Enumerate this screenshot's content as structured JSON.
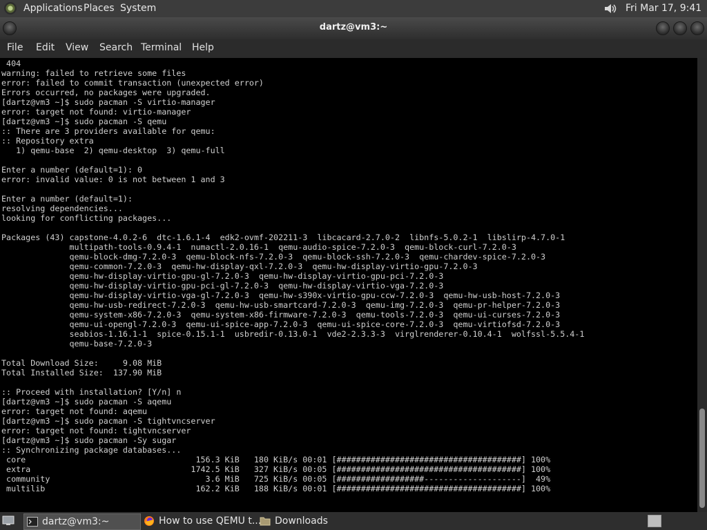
{
  "top_panel": {
    "menus": [
      "Applications",
      "Places",
      "System"
    ],
    "clock": "Fri Mar 17,  9:41 AM",
    "icons": {
      "logo": "distro-logo-icon",
      "volume": "speaker-volume-icon"
    }
  },
  "window": {
    "title": "dartz@vm3:~",
    "menu": [
      "File",
      "Edit",
      "View",
      "Search",
      "Terminal",
      "Help"
    ]
  },
  "terminal": {
    "lines": [
      " 404",
      "warning: failed to retrieve some files",
      "error: failed to commit transaction (unexpected error)",
      "Errors occurred, no packages were upgraded.",
      "[dartz@vm3 ~]$ sudo pacman -S virtio-manager",
      "error: target not found: virtio-manager",
      "[dartz@vm3 ~]$ sudo pacman -S qemu",
      ":: There are 3 providers available for qemu:",
      ":: Repository extra",
      "   1) qemu-base  2) qemu-desktop  3) qemu-full",
      "",
      "Enter a number (default=1): 0",
      "error: invalid value: 0 is not between 1 and 3",
      "",
      "Enter a number (default=1):",
      "resolving dependencies...",
      "looking for conflicting packages...",
      "",
      "Packages (43) capstone-4.0.2-6  dtc-1.6.1-4  edk2-ovmf-202211-3  libcacard-2.7.0-2  libnfs-5.0.2-1  libslirp-4.7.0-1",
      "              multipath-tools-0.9.4-1  numactl-2.0.16-1  qemu-audio-spice-7.2.0-3  qemu-block-curl-7.2.0-3",
      "              qemu-block-dmg-7.2.0-3  qemu-block-nfs-7.2.0-3  qemu-block-ssh-7.2.0-3  qemu-chardev-spice-7.2.0-3",
      "              qemu-common-7.2.0-3  qemu-hw-display-qxl-7.2.0-3  qemu-hw-display-virtio-gpu-7.2.0-3",
      "              qemu-hw-display-virtio-gpu-gl-7.2.0-3  qemu-hw-display-virtio-gpu-pci-7.2.0-3",
      "              qemu-hw-display-virtio-gpu-pci-gl-7.2.0-3  qemu-hw-display-virtio-vga-7.2.0-3",
      "              qemu-hw-display-virtio-vga-gl-7.2.0-3  qemu-hw-s390x-virtio-gpu-ccw-7.2.0-3  qemu-hw-usb-host-7.2.0-3",
      "              qemu-hw-usb-redirect-7.2.0-3  qemu-hw-usb-smartcard-7.2.0-3  qemu-img-7.2.0-3  qemu-pr-helper-7.2.0-3",
      "              qemu-system-x86-7.2.0-3  qemu-system-x86-firmware-7.2.0-3  qemu-tools-7.2.0-3  qemu-ui-curses-7.2.0-3",
      "              qemu-ui-opengl-7.2.0-3  qemu-ui-spice-app-7.2.0-3  qemu-ui-spice-core-7.2.0-3  qemu-virtiofsd-7.2.0-3",
      "              seabios-1.16.1-1  spice-0.15.1-1  usbredir-0.13.0-1  vde2-2.3.3-3  virglrenderer-0.10.4-1  wolfssl-5.5.4-1",
      "              qemu-base-7.2.0-3",
      "",
      "Total Download Size:     9.08 MiB",
      "Total Installed Size:  137.90 MiB",
      "",
      ":: Proceed with installation? [Y/n] n",
      "[dartz@vm3 ~]$ sudo pacman -S aqemu",
      "error: target not found: aqemu",
      "[dartz@vm3 ~]$ sudo pacman -S tightvncserver",
      "error: target not found: tightvncserver",
      "[dartz@vm3 ~]$ sudo pacman -Sy sugar",
      ":: Synchronizing package databases...",
      " core                                   156.3 KiB   180 KiB/s 00:01 [######################################] 100%",
      " extra                                 1742.5 KiB   327 KiB/s 00:05 [######################################] 100%",
      " community                                3.6 MiB   725 KiB/s 00:05 [##################--------------------]  49%",
      " multilib                               162.2 KiB   188 KiB/s 00:01 [######################################] 100%"
    ],
    "scroll_position": 0.77
  },
  "taskbar": {
    "items": [
      {
        "label": "dartz@vm3:~",
        "icon": "terminal-icon",
        "active": true
      },
      {
        "label": "How to use QEMU t...",
        "icon": "firefox-icon",
        "active": false
      },
      {
        "label": "Downloads",
        "icon": "folder-icon",
        "active": false
      }
    ],
    "icons": {
      "show_desktop": "show-desktop-icon",
      "workspace": "workspace-switcher-icon"
    }
  }
}
